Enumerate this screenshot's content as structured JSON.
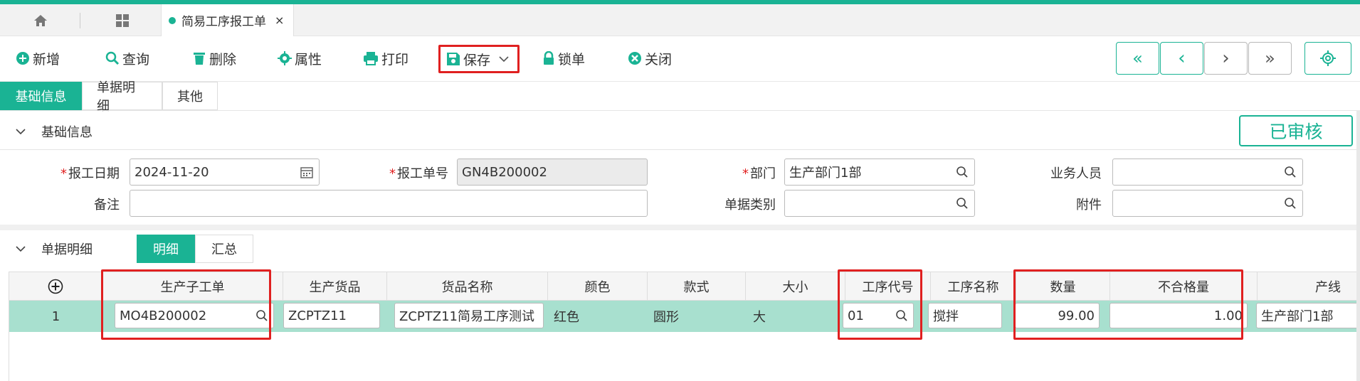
{
  "tabbar": {
    "doc_tab_title": "简易工序报工单",
    "close_glyph": "×"
  },
  "toolbar": {
    "new": "新增",
    "query": "查询",
    "delete": "删除",
    "properties": "属性",
    "print": "打印",
    "save": "保存",
    "lock": "锁单",
    "close": "关闭",
    "nav_first": "«",
    "nav_prev": "‹",
    "nav_next": "›",
    "nav_last": "»"
  },
  "section_tabs": [
    "基础信息",
    "单据明细",
    "其他"
  ],
  "basic_section": {
    "title": "基础信息",
    "status": "已审核",
    "fields": {
      "report_date_label": "报工日期",
      "report_date_value": "2024-11-20",
      "report_no_label": "报工单号",
      "report_no_value": "GN4B200002",
      "dept_label": "部门",
      "dept_value": "生产部门1部",
      "salesperson_label": "业务人员",
      "salesperson_value": "",
      "remark_label": "备注",
      "remark_value": "",
      "doc_type_label": "单据类别",
      "doc_type_value": "",
      "attachment_label": "附件",
      "attachment_value": ""
    }
  },
  "detail_section": {
    "title": "单据明细",
    "sub_tabs": [
      "明细",
      "汇总"
    ],
    "columns": [
      "生产子工单",
      "生产货品",
      "货品名称",
      "颜色",
      "款式",
      "大小",
      "工序代号",
      "工序名称",
      "数量",
      "不合格量",
      "产线"
    ],
    "rows": [
      {
        "index": "1",
        "sub_order": "MO4B200002",
        "product": "ZCPTZ11",
        "product_name": "ZCPTZ11简易工序测试",
        "color": "红色",
        "style": "圆形",
        "size": "大",
        "process_code": "01",
        "process_name": "搅拌",
        "quantity": "99.00",
        "defect_qty": "1.00",
        "line": "生产部门1部"
      }
    ]
  },
  "colors": {
    "accent": "#1ab394",
    "highlight_box": "#e02020",
    "selected_row": "#a8e0cf"
  }
}
